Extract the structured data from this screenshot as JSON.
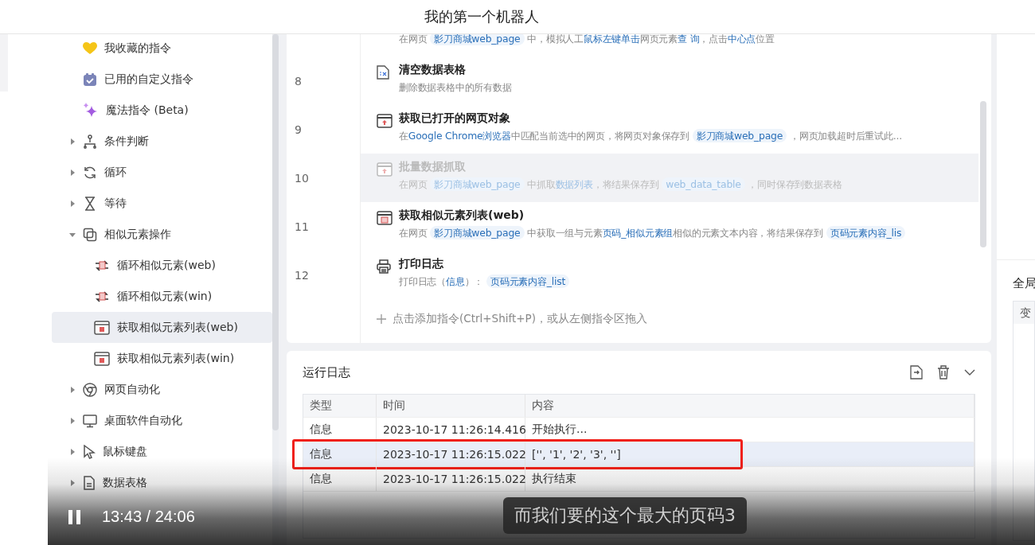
{
  "window": {
    "title": "我的第一个机器人"
  },
  "sidebar": {
    "items": [
      {
        "kind": "favorite",
        "label": "我收藏的指令",
        "selected": false
      },
      {
        "kind": "custom",
        "label": "已用的自定义指令",
        "selected": false
      },
      {
        "kind": "magic",
        "label": "魔法指令 (Beta)",
        "selected": false
      },
      {
        "kind": "branch",
        "label": "条件判断",
        "expanded": false,
        "selected": false
      },
      {
        "kind": "loop",
        "label": "循环",
        "expanded": false,
        "selected": false
      },
      {
        "kind": "wait",
        "label": "等待",
        "expanded": false,
        "selected": false
      },
      {
        "kind": "similar",
        "label": "相似元素操作",
        "expanded": true,
        "selected": false,
        "children": [
          {
            "kind": "loop-item",
            "label": "循环相似元素(web)",
            "selected": false
          },
          {
            "kind": "loop-item",
            "label": "循环相似元素(win)",
            "selected": false
          },
          {
            "kind": "list-item",
            "label": "获取相似元素列表(web)",
            "selected": true
          },
          {
            "kind": "list-item",
            "label": "获取相似元素列表(win)",
            "selected": false
          }
        ]
      },
      {
        "kind": "web",
        "label": "网页自动化",
        "expanded": false,
        "selected": false
      },
      {
        "kind": "desktop",
        "label": "桌面软件自动化",
        "expanded": false,
        "selected": false
      },
      {
        "kind": "mouse",
        "label": "鼠标键盘",
        "expanded": false,
        "selected": false
      },
      {
        "kind": "table",
        "label": "数据表格",
        "expanded": false,
        "selected": false
      }
    ]
  },
  "steps": [
    {
      "kind": "click",
      "selected": false,
      "disabled": false,
      "description": [
        {
          "kind": "plain",
          "text": "在网页 "
        },
        {
          "kind": "chip",
          "text": "影刀商城web_page"
        },
        {
          "kind": "plain",
          "text": " 中，模拟人工"
        },
        {
          "kind": "link",
          "text": "鼠标左键单击"
        },
        {
          "kind": "plain",
          "text": "网页元素"
        },
        {
          "kind": "link",
          "text": "查 询"
        },
        {
          "kind": "plain",
          "text": "，点击"
        },
        {
          "kind": "link",
          "text": "中心点"
        },
        {
          "kind": "plain",
          "text": "位置"
        }
      ]
    },
    {
      "number": "8",
      "kind": "table-clear",
      "title": "清空数据表格",
      "selected": false,
      "disabled": false,
      "description": [
        {
          "kind": "plain",
          "text": "删除数据表格中的所有数据"
        }
      ]
    },
    {
      "number": "9",
      "kind": "browser",
      "title": "获取已打开的网页对象",
      "selected": false,
      "disabled": false,
      "description": [
        {
          "kind": "plain",
          "text": "在"
        },
        {
          "kind": "link",
          "text": "Google Chrome浏览器"
        },
        {
          "kind": "plain",
          "text": "中匹配当前选中的网页，将网页对象保存到 "
        },
        {
          "kind": "chip",
          "text": "影刀商城web_page"
        },
        {
          "kind": "plain",
          "text": " ，网页加载超时后重试此..."
        }
      ]
    },
    {
      "number": "10",
      "kind": "grab",
      "title": "批量数据抓取",
      "selected": true,
      "disabled": true,
      "description": [
        {
          "kind": "plain",
          "text": "在网页 "
        },
        {
          "kind": "chip",
          "text": "影刀商城web_page"
        },
        {
          "kind": "plain",
          "text": " 中抓取"
        },
        {
          "kind": "link",
          "text": "数据列表"
        },
        {
          "kind": "plain",
          "text": "，将结果保存到 "
        },
        {
          "kind": "chip",
          "text": "web_data_table"
        },
        {
          "kind": "plain",
          "text": " ，同时保存到数据表格"
        }
      ]
    },
    {
      "number": "11",
      "kind": "similar-list",
      "title": "获取相似元素列表(web)",
      "selected": false,
      "disabled": false,
      "description": [
        {
          "kind": "plain",
          "text": "在网页 "
        },
        {
          "kind": "chip",
          "text": "影刀商城web_page"
        },
        {
          "kind": "plain",
          "text": " 中获取一组与元素"
        },
        {
          "kind": "link",
          "text": "页码_相似元素组"
        },
        {
          "kind": "plain",
          "text": "相似的元素文本内容，将结果保存到 "
        },
        {
          "kind": "chip",
          "text": "页码元素内容_lis"
        }
      ]
    },
    {
      "number": "12",
      "kind": "print",
      "title": "打印日志",
      "selected": false,
      "disabled": false,
      "description": [
        {
          "kind": "plain",
          "text": "打印日志（"
        },
        {
          "kind": "link",
          "text": "信息"
        },
        {
          "kind": "plain",
          "text": "）： "
        },
        {
          "kind": "chip",
          "text": "页码元素内容_list"
        }
      ]
    }
  ],
  "add_hint": "点击添加指令(Ctrl+Shift+P)，或从左侧指令区拖入",
  "run_log": {
    "title": "运行日志",
    "columns": [
      "类型",
      "时间",
      "内容"
    ],
    "rows": [
      {
        "cells": [
          "信息",
          "2023-10-17 11:26:14.416",
          "开始执行..."
        ],
        "selected": false,
        "annotated": false
      },
      {
        "cells": [
          "信息",
          "2023-10-17 11:26:15.022",
          "['', '1', '2', '3', '']"
        ],
        "selected": true,
        "annotated": true
      },
      {
        "cells": [
          "信息",
          "2023-10-17 11:26:15.022",
          "执行结束"
        ],
        "selected": false,
        "annotated": false
      }
    ]
  },
  "right_panel": {
    "title": "全局",
    "column_1": "变"
  },
  "video": {
    "playing": true,
    "time": "13:43 / 24:06",
    "subtitle": "而我们要的这个最大的页码3"
  }
}
